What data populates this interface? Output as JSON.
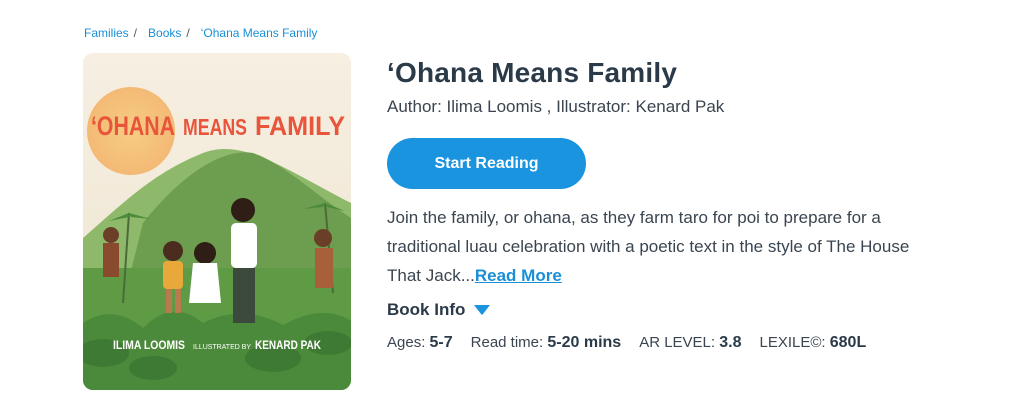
{
  "breadcrumb": {
    "items": [
      "Families",
      "Books",
      "‘Ohana Means Family"
    ],
    "separator": "/"
  },
  "cover": {
    "title_part1": "‘OHANA",
    "title_part2": "MEANS",
    "title_part3": "FAMILY",
    "author": "ILIMA LOOMIS",
    "illustrated_by": "ILLUSTRATED BY",
    "illustrator": "KENARD PAK"
  },
  "book": {
    "title": "‘Ohana Means Family",
    "credits": "Author: Ilima Loomis , Illustrator: Kenard Pak",
    "description": "Join the family, or ohana, as they farm taro for poi to prepare for a traditional luau celebration with a poetic text in the style of The House That Jack...",
    "read_more": "Read More"
  },
  "actions": {
    "start_reading": "Start Reading",
    "book_info": "Book Info"
  },
  "meta": {
    "ages_label": "Ages:",
    "ages_value": "5-7",
    "read_time_label": "Read time:",
    "read_time_value": "5-20 mins",
    "ar_label": "AR LEVEL:",
    "ar_value": "3.8",
    "lexile_label": "LEXILE©:",
    "lexile_value": "680L"
  },
  "colors": {
    "accent": "#1b94e0",
    "link": "#1a8fd8",
    "title_text": "#2b3a48",
    "cover_orange": "#e8553a"
  }
}
